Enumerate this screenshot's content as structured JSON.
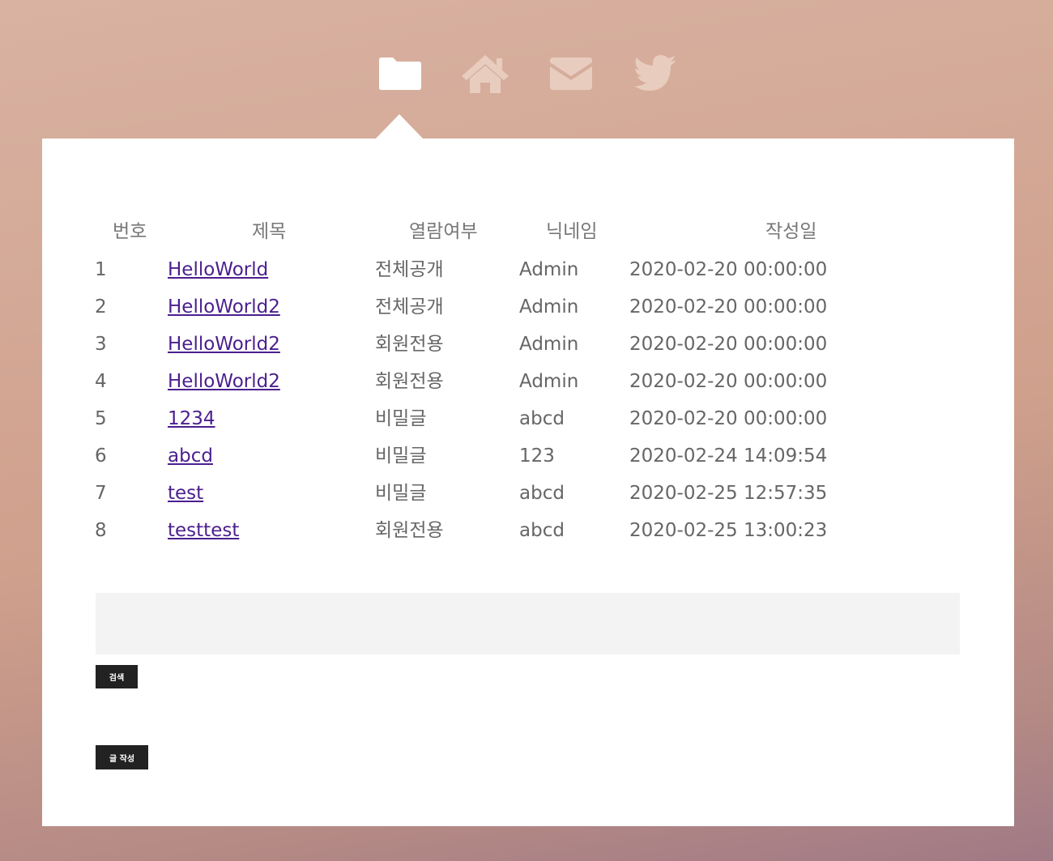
{
  "nav": {
    "items": [
      {
        "icon": "folder-icon",
        "active": true
      },
      {
        "icon": "home-icon",
        "active": false
      },
      {
        "icon": "envelope-icon",
        "active": false
      },
      {
        "icon": "twitter-icon",
        "active": false
      }
    ],
    "active_color": "#ffffff",
    "inactive_color": "#e8cdbf"
  },
  "board": {
    "headers": {
      "number": "번호",
      "title": "제목",
      "visibility": "열람여부",
      "nickname": "닉네임",
      "date": "작성일"
    },
    "rows": [
      {
        "number": "1",
        "title": "HelloWorld",
        "visibility": "전체공개",
        "nickname": "Admin",
        "date": "2020-02-20 00:00:00"
      },
      {
        "number": "2",
        "title": "HelloWorld2",
        "visibility": "전체공개",
        "nickname": "Admin",
        "date": "2020-02-20 00:00:00"
      },
      {
        "number": "3",
        "title": "HelloWorld2",
        "visibility": "회원전용",
        "nickname": "Admin",
        "date": "2020-02-20 00:00:00"
      },
      {
        "number": "4",
        "title": "HelloWorld2",
        "visibility": "회원전용",
        "nickname": "Admin",
        "date": "2020-02-20 00:00:00"
      },
      {
        "number": "5",
        "title": "1234",
        "visibility": "비밀글",
        "nickname": "abcd",
        "date": "2020-02-20 00:00:00"
      },
      {
        "number": "6",
        "title": "abcd",
        "visibility": "비밀글",
        "nickname": "123",
        "date": "2020-02-24 14:09:54"
      },
      {
        "number": "7",
        "title": "test",
        "visibility": "비밀글",
        "nickname": "abcd",
        "date": "2020-02-25 12:57:35"
      },
      {
        "number": "8",
        "title": "testtest",
        "visibility": "회원전용",
        "nickname": "abcd",
        "date": "2020-02-25 13:00:23"
      }
    ]
  },
  "search": {
    "value": "",
    "button_label": "검색"
  },
  "write_button_label": "글 작성",
  "colors": {
    "link": "#4b1f8e",
    "button_bg": "#222222",
    "search_bg": "#f3f3f3"
  }
}
